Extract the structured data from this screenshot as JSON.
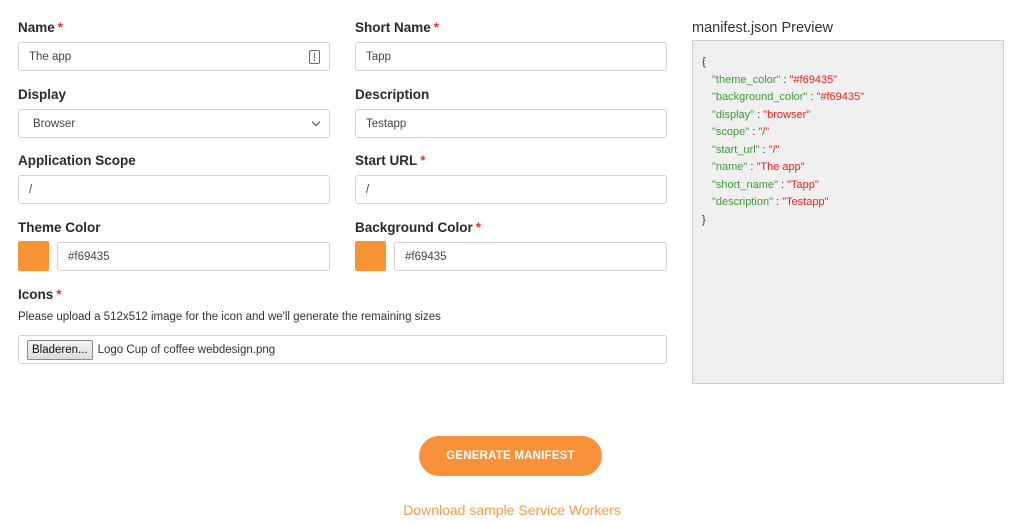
{
  "form": {
    "name": {
      "label": "Name",
      "required": "*",
      "value": "The app"
    },
    "short_name": {
      "label": "Short Name",
      "required": "*",
      "value": "Tapp"
    },
    "display": {
      "label": "Display",
      "value": "Browser"
    },
    "description": {
      "label": "Description",
      "value": "Testapp"
    },
    "scope": {
      "label": "Application Scope",
      "value": "/"
    },
    "start_url": {
      "label": "Start URL",
      "required": "*",
      "value": "/"
    },
    "theme_color": {
      "label": "Theme Color",
      "value": "#f69435",
      "swatch": "#f69435"
    },
    "background_color": {
      "label": "Background Color",
      "required": "*",
      "value": "#f69435",
      "swatch": "#f69435"
    },
    "icons": {
      "label": "Icons",
      "required": "*",
      "help": "Please upload a 512x512 image for the icon and we'll generate the remaining sizes",
      "browse_label": "Bladeren...",
      "file_name": "Logo Cup of coffee webdesign.png"
    }
  },
  "preview": {
    "title": "manifest.json Preview",
    "open": "{",
    "close": "}",
    "entries": [
      {
        "key": "\"theme_color\"",
        "value": "\"#f69435\""
      },
      {
        "key": "\"background_color\"",
        "value": "\"#f69435\""
      },
      {
        "key": "\"display\"",
        "value": "\"browser\""
      },
      {
        "key": "\"scope\"",
        "value": "\"/\""
      },
      {
        "key": "\"start_url\"",
        "value": "\"/\""
      },
      {
        "key": "\"name\"",
        "value": "\"The app\""
      },
      {
        "key": "\"short_name\"",
        "value": "\"Tapp\""
      },
      {
        "key": "\"description\"",
        "value": "\"Testapp\""
      }
    ],
    "separator": " : "
  },
  "actions": {
    "generate_label": "GENERATE MANIFEST",
    "download_label": "Download sample Service Workers"
  },
  "colors": {
    "accent": "#f7923a",
    "json_key": "#3d9b36",
    "json_value": "#e2231a",
    "required": "#e8332f"
  },
  "icons": {
    "name_field_trailing": "contact-card-icon",
    "display_select": "chevron-down-icon"
  }
}
